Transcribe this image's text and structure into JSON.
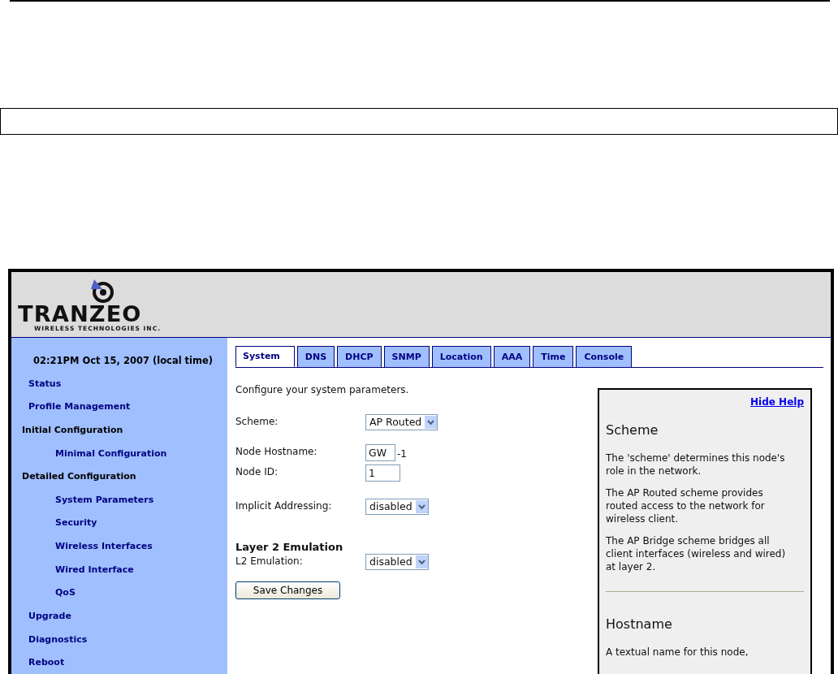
{
  "logo": {
    "name": "TRANZEO",
    "tagline": "WIRELESS TECHNOLOGIES INC."
  },
  "sidebar": {
    "datetime": "02:21PM Oct 15, 2007 (local time)",
    "items": [
      {
        "label": "Status",
        "kind": "link"
      },
      {
        "label": "Profile Management",
        "kind": "link"
      },
      {
        "label": "Initial Configuration",
        "kind": "heading",
        "children": [
          {
            "label": "Minimal Configuration"
          }
        ]
      },
      {
        "label": "Detailed Configuration",
        "kind": "heading",
        "children": [
          {
            "label": "System Parameters"
          },
          {
            "label": "Security"
          },
          {
            "label": "Wireless Interfaces"
          },
          {
            "label": "Wired Interface"
          },
          {
            "label": "QoS"
          }
        ]
      },
      {
        "label": "Upgrade",
        "kind": "link"
      },
      {
        "label": "Diagnostics",
        "kind": "link"
      },
      {
        "label": "Reboot",
        "kind": "link"
      }
    ]
  },
  "tabs": [
    {
      "label": "System",
      "selected": true
    },
    {
      "label": "DNS",
      "selected": false
    },
    {
      "label": "DHCP",
      "selected": false
    },
    {
      "label": "SNMP",
      "selected": false
    },
    {
      "label": "Location",
      "selected": false
    },
    {
      "label": "AAA",
      "selected": false
    },
    {
      "label": "Time",
      "selected": false
    },
    {
      "label": "Console",
      "selected": false
    }
  ],
  "intro": "Configure your system parameters.",
  "form": {
    "scheme": {
      "label": "Scheme:",
      "value": "AP Routed"
    },
    "hostname": {
      "label": "Node Hostname:",
      "value": "GW",
      "suffix": "-1"
    },
    "node_id": {
      "label": "Node ID:",
      "value": "1"
    },
    "implicit": {
      "label": "Implicit Addressing:",
      "value": "disabled"
    },
    "layer2_heading": "Layer 2 Emulation",
    "l2": {
      "label": "L2 Emulation:",
      "value": "disabled"
    },
    "save_button": "Save Changes"
  },
  "help": {
    "hide_link": "Hide Help",
    "sections": [
      {
        "title": "Scheme",
        "paragraphs": [
          "The 'scheme' determines this node's role in the network.",
          "The AP Routed scheme provides routed access to the network for wireless client.",
          "The AP Bridge scheme bridges all client interfaces (wireless and wired) at layer 2."
        ]
      },
      {
        "title": "Hostname",
        "paragraphs": [
          "A textual name for this node,"
        ]
      }
    ]
  }
}
